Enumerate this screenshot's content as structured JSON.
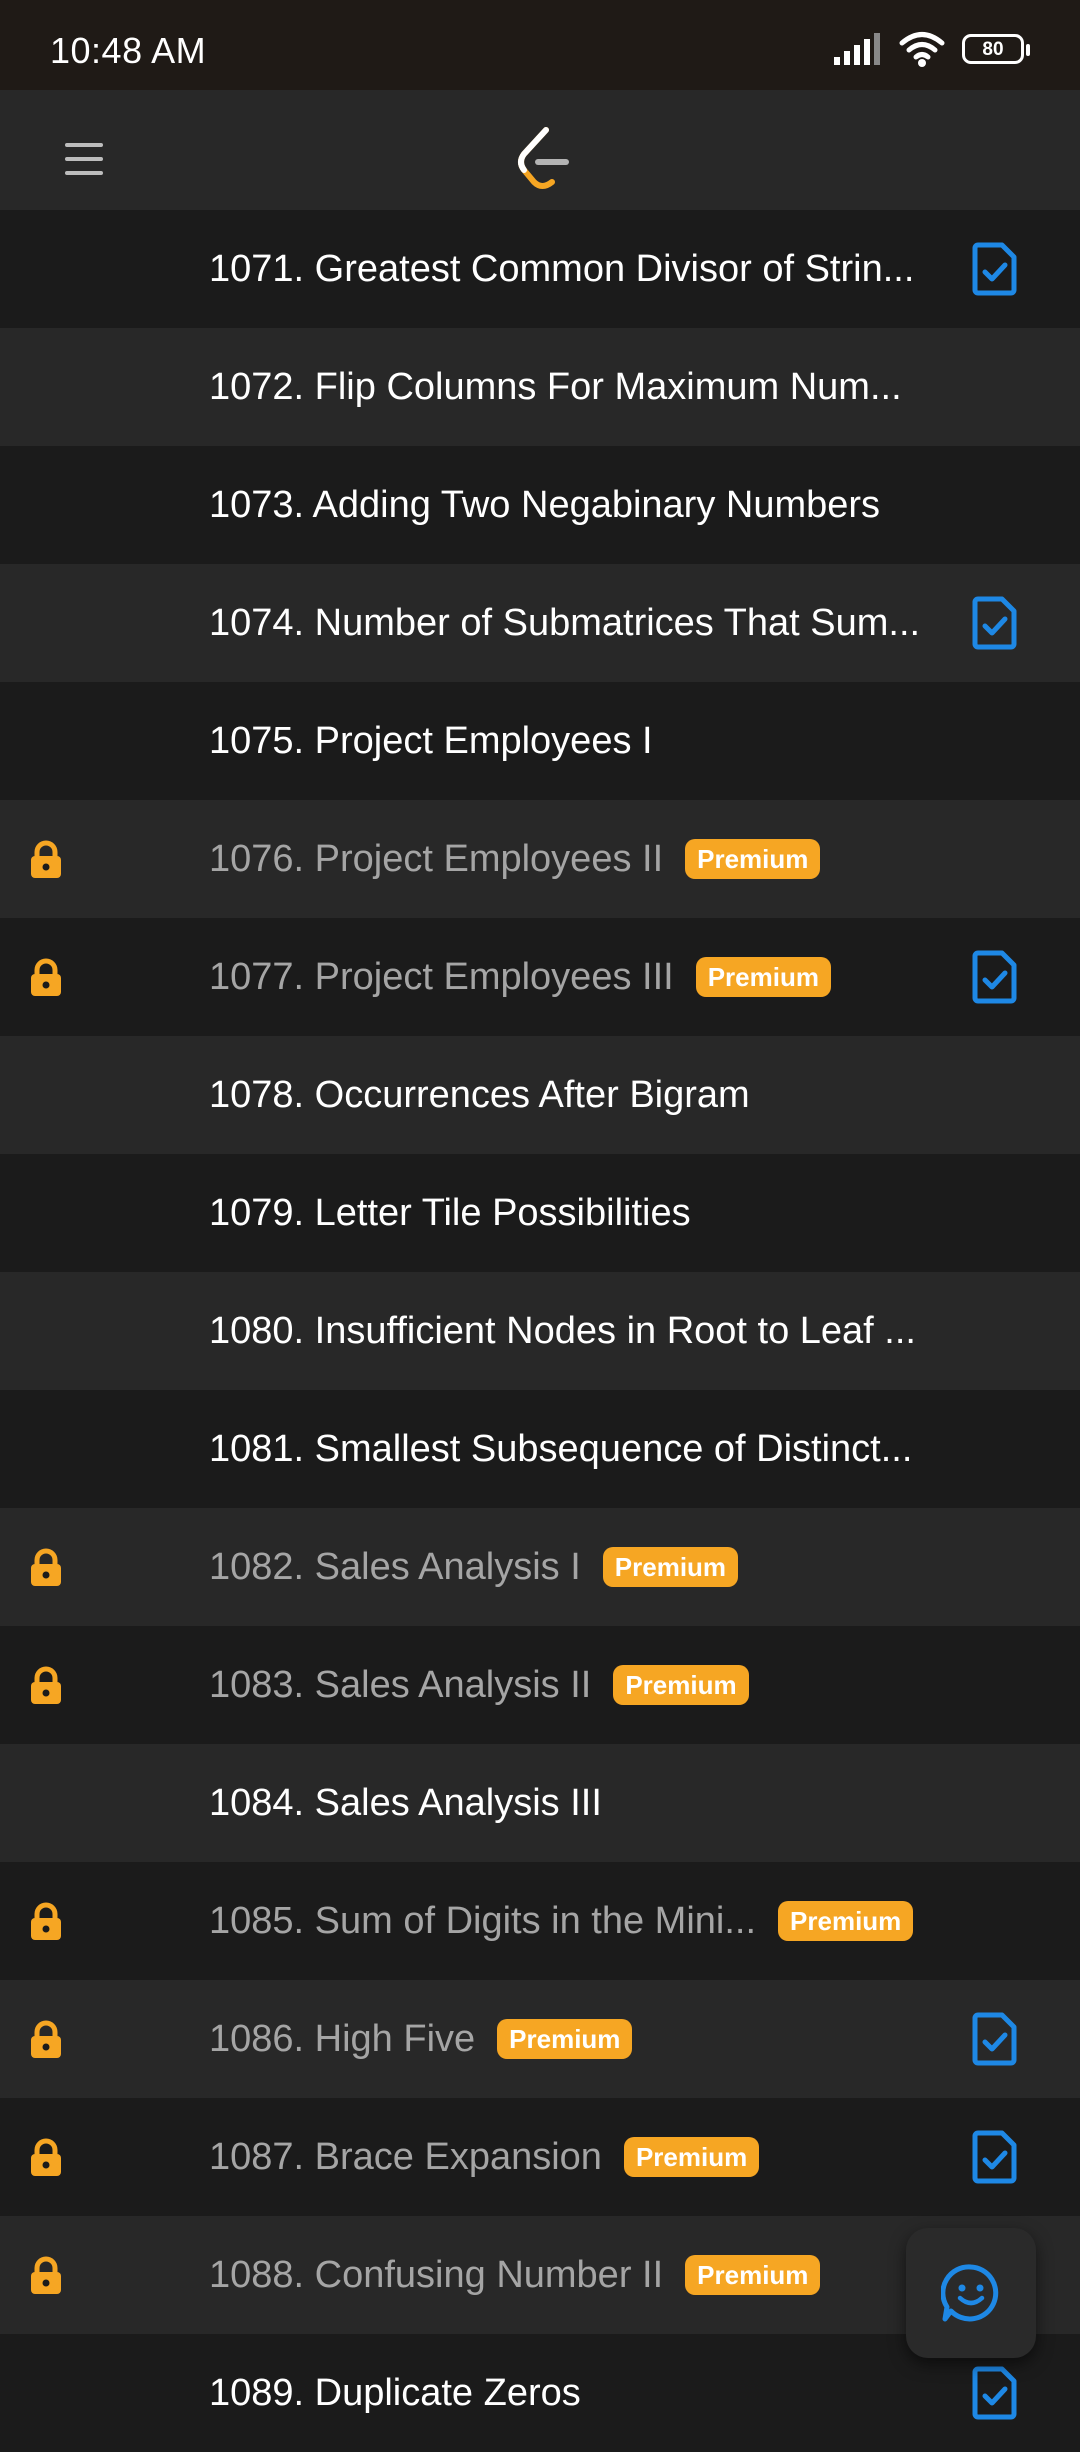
{
  "status_bar": {
    "time": "10:48 AM",
    "battery": "80"
  },
  "colors": {
    "accent": "#f6a623",
    "doc_icon": "#1e88e5",
    "row_dark": "#1b1b1b",
    "row_light": "#282828"
  },
  "problems": [
    {
      "title": "1071. Greatest Common Divisor of Strin...",
      "locked": false,
      "premium": false,
      "solved_doc": true
    },
    {
      "title": "1072. Flip Columns For Maximum Num...",
      "locked": false,
      "premium": false,
      "solved_doc": false
    },
    {
      "title": "1073. Adding Two Negabinary Numbers",
      "locked": false,
      "premium": false,
      "solved_doc": false
    },
    {
      "title": "1074. Number of Submatrices That Sum...",
      "locked": false,
      "premium": false,
      "solved_doc": true
    },
    {
      "title": "1075. Project Employees I",
      "locked": false,
      "premium": false,
      "solved_doc": false
    },
    {
      "title": "1076. Project Employees II",
      "locked": true,
      "premium": true,
      "badge": "Premium",
      "solved_doc": false
    },
    {
      "title": "1077. Project Employees III",
      "locked": true,
      "premium": true,
      "badge": "Premium",
      "solved_doc": true
    },
    {
      "title": "1078. Occurrences After Bigram",
      "locked": false,
      "premium": false,
      "solved_doc": false
    },
    {
      "title": "1079. Letter Tile Possibilities",
      "locked": false,
      "premium": false,
      "solved_doc": false
    },
    {
      "title": "1080. Insufficient Nodes in Root to Leaf ...",
      "locked": false,
      "premium": false,
      "solved_doc": false
    },
    {
      "title": "1081. Smallest Subsequence of Distinct...",
      "locked": false,
      "premium": false,
      "solved_doc": false
    },
    {
      "title": "1082. Sales Analysis I",
      "locked": true,
      "premium": true,
      "badge": "Premium",
      "solved_doc": false
    },
    {
      "title": "1083. Sales Analysis II",
      "locked": true,
      "premium": true,
      "badge": "Premium",
      "solved_doc": false
    },
    {
      "title": "1084. Sales Analysis III",
      "locked": false,
      "premium": false,
      "solved_doc": false
    },
    {
      "title": "1085. Sum of Digits in the Mini...",
      "locked": true,
      "premium": true,
      "badge": "Premium",
      "solved_doc": false
    },
    {
      "title": "1086. High Five",
      "locked": true,
      "premium": true,
      "badge": "Premium",
      "solved_doc": true
    },
    {
      "title": "1087. Brace Expansion",
      "locked": true,
      "premium": true,
      "badge": "Premium",
      "solved_doc": true
    },
    {
      "title": "1088. Confusing Number II",
      "locked": true,
      "premium": true,
      "badge": "Premium",
      "solved_doc": false
    },
    {
      "title": "1089. Duplicate Zeros",
      "locked": false,
      "premium": false,
      "solved_doc": true
    }
  ]
}
